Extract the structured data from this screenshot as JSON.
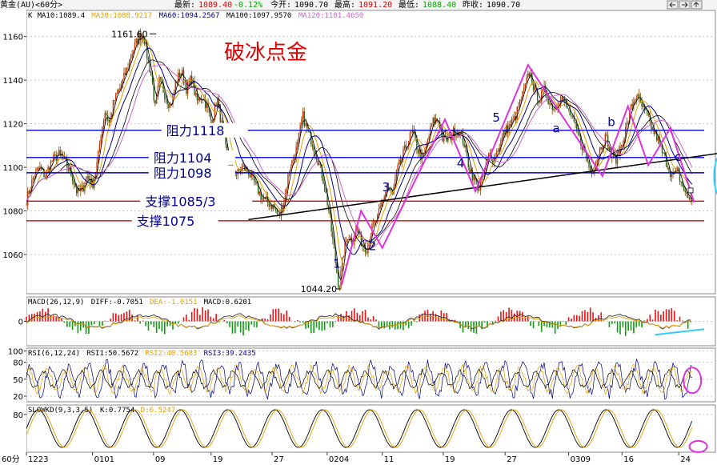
{
  "app": {
    "title": "黄金(AU)<60分>",
    "quote": {
      "latest_label": "最新:",
      "latest": "1089.40",
      "change": "-0.12%",
      "open_label": "今开:",
      "open": "1090.70",
      "high_label": "最高:",
      "high": "1091.20",
      "low_label": "最低:",
      "low": "1088.40",
      "prev_close_label": "昨收:",
      "prev_close": "1090.70"
    },
    "period_label": "60分",
    "nav_icons": [
      "arrow-left-icon",
      "arrow-right-icon",
      "arrow-up-icon"
    ]
  },
  "colors": {
    "ma10": "#000000",
    "ma30": "#e0a000",
    "ma60": "#000080",
    "ma100": "#000000",
    "ma120": "#cc66cc",
    "resistance_line": "#0000cc",
    "support_line": "#dd0000",
    "trend_line": "#000000",
    "wave_line": "#dd33dd",
    "annotation_blue": "#000090",
    "annotation_red": "#dd0000",
    "ellipse_cyan": "#33ccff",
    "candle": "#8a5a1a"
  },
  "chart_data": [
    {
      "type": "candlestick",
      "name": "price",
      "legend": [
        {
          "key": "K",
          "text": "K",
          "color": "#000000"
        },
        {
          "key": "ma10",
          "text": "MA10:1089.4",
          "color": "#000000"
        },
        {
          "key": "ma30",
          "text": "MA30:1088.9217",
          "color": "#e0a000"
        },
        {
          "key": "ma60",
          "text": "MA60:1094.2567",
          "color": "#000080"
        },
        {
          "key": "ma100",
          "text": "MA100:1097.9570",
          "color": "#000000"
        },
        {
          "key": "ma120",
          "text": "MA120:1101.4650",
          "color": "#cc66cc"
        }
      ],
      "ylim": [
        1042,
        1172
      ],
      "yticks": [
        1060,
        1080,
        1100,
        1120,
        1140,
        1160
      ],
      "ytick_labels": [
        "1060",
        "1080",
        "1100",
        "1120",
        "1140",
        "1160"
      ],
      "x_dates": [
        "1223",
        "0101",
        "09",
        "19",
        "27",
        "0204",
        "11",
        "19",
        "27",
        "0309",
        "16",
        "24"
      ],
      "x_date_pos": [
        0,
        78,
        150,
        218,
        290,
        355,
        420,
        492,
        565,
        640,
        703,
        770
      ],
      "x_range": [
        0,
        800
      ],
      "price_path": [
        [
          0,
          1085
        ],
        [
          8,
          1095
        ],
        [
          15,
          1100
        ],
        [
          22,
          1096
        ],
        [
          30,
          1103
        ],
        [
          38,
          1106
        ],
        [
          46,
          1102
        ],
        [
          54,
          1096
        ],
        [
          60,
          1088
        ],
        [
          66,
          1090
        ],
        [
          72,
          1096
        ],
        [
          78,
          1092
        ],
        [
          84,
          1103
        ],
        [
          88,
          1116
        ],
        [
          93,
          1126
        ],
        [
          98,
          1120
        ],
        [
          103,
          1130
        ],
        [
          110,
          1136
        ],
        [
          118,
          1144
        ],
        [
          125,
          1153
        ],
        [
          133,
          1160
        ],
        [
          138,
          1161.6
        ],
        [
          142,
          1152
        ],
        [
          148,
          1141
        ],
        [
          152,
          1127
        ],
        [
          157,
          1140
        ],
        [
          163,
          1134
        ],
        [
          170,
          1128
        ],
        [
          177,
          1140
        ],
        [
          183,
          1144
        ],
        [
          189,
          1136
        ],
        [
          195,
          1141
        ],
        [
          201,
          1130
        ],
        [
          207,
          1133
        ],
        [
          213,
          1128
        ],
        [
          219,
          1120
        ],
        [
          225,
          1132
        ],
        [
          231,
          1118
        ],
        [
          237,
          1104
        ],
        [
          243,
          1098
        ],
        [
          249,
          1097
        ],
        [
          255,
          1100
        ],
        [
          262,
          1098
        ],
        [
          270,
          1092
        ],
        [
          278,
          1086
        ],
        [
          285,
          1084
        ],
        [
          292,
          1082
        ],
        [
          298,
          1077
        ],
        [
          305,
          1086
        ],
        [
          310,
          1099
        ],
        [
          315,
          1104
        ],
        [
          320,
          1110
        ],
        [
          326,
          1124
        ],
        [
          331,
          1117
        ],
        [
          337,
          1112
        ],
        [
          343,
          1105
        ],
        [
          350,
          1095
        ],
        [
          357,
          1080
        ],
        [
          363,
          1062
        ],
        [
          369,
          1044.2
        ],
        [
          374,
          1060
        ],
        [
          379,
          1069
        ],
        [
          385,
          1066
        ],
        [
          390,
          1072
        ],
        [
          396,
          1065
        ],
        [
          402,
          1063
        ],
        [
          408,
          1072
        ],
        [
          414,
          1076
        ],
        [
          420,
          1084
        ],
        [
          426,
          1092
        ],
        [
          432,
          1087
        ],
        [
          438,
          1099
        ],
        [
          444,
          1105
        ],
        [
          450,
          1112
        ],
        [
          456,
          1116
        ],
        [
          462,
          1108
        ],
        [
          468,
          1104
        ],
        [
          474,
          1113
        ],
        [
          480,
          1121
        ],
        [
          486,
          1122
        ],
        [
          492,
          1112
        ],
        [
          498,
          1113
        ],
        [
          504,
          1116
        ],
        [
          510,
          1117
        ],
        [
          516,
          1112
        ],
        [
          522,
          1101
        ],
        [
          528,
          1095
        ],
        [
          534,
          1090
        ],
        [
          540,
          1096
        ],
        [
          546,
          1106
        ],
        [
          552,
          1104
        ],
        [
          558,
          1110
        ],
        [
          564,
          1116
        ],
        [
          570,
          1119
        ],
        [
          576,
          1122
        ],
        [
          582,
          1129
        ],
        [
          588,
          1136
        ],
        [
          594,
          1144
        ],
        [
          600,
          1135
        ],
        [
          606,
          1131
        ],
        [
          612,
          1136
        ],
        [
          618,
          1129
        ],
        [
          624,
          1127
        ],
        [
          630,
          1133
        ],
        [
          636,
          1129
        ],
        [
          642,
          1124
        ],
        [
          648,
          1118
        ],
        [
          654,
          1112
        ],
        [
          660,
          1106
        ],
        [
          666,
          1098
        ],
        [
          672,
          1102
        ],
        [
          678,
          1110
        ],
        [
          684,
          1114
        ],
        [
          690,
          1105
        ],
        [
          696,
          1104
        ],
        [
          702,
          1110
        ],
        [
          708,
          1118
        ],
        [
          714,
          1128
        ],
        [
          720,
          1133
        ],
        [
          726,
          1128
        ],
        [
          732,
          1124
        ],
        [
          738,
          1118
        ],
        [
          744,
          1114
        ],
        [
          750,
          1107
        ],
        [
          756,
          1102
        ],
        [
          762,
          1096
        ],
        [
          768,
          1098
        ],
        [
          774,
          1092
        ],
        [
          780,
          1086
        ]
      ],
      "last_price_marker": {
        "x": 784,
        "y": 1089.4
      },
      "high_label": {
        "text": "1161.60",
        "x": 138,
        "y": 1161.6
      },
      "low_label": {
        "text": "1044.20",
        "x": 369,
        "y": 1044.2
      },
      "horizontal_levels": [
        {
          "label": "阻力1118",
          "value": 1117,
          "type": "resistance",
          "x_label": 165
        },
        {
          "label": "阻力1104",
          "value": 1104.5,
          "type": "resistance",
          "x_label": 150
        },
        {
          "label": "阻力1098",
          "value": 1097.5,
          "type": "resistance",
          "x_label": 150
        },
        {
          "label": "支撑1085/3",
          "value": 1084.5,
          "type": "support",
          "x_label": 140
        },
        {
          "label": "支撑1075",
          "value": 1075.5,
          "type": "support",
          "x_label": 130
        }
      ],
      "trend_line": {
        "from": [
          262,
          1076
        ],
        "to": [
          846,
          1108
        ]
      },
      "wave_path": [
        [
          372,
          1046
        ],
        [
          395,
          1080
        ],
        [
          420,
          1063
        ],
        [
          494,
          1122
        ],
        [
          530,
          1089
        ],
        [
          592,
          1147
        ],
        [
          680,
          1096
        ],
        [
          710,
          1128
        ],
        [
          734,
          1101
        ],
        [
          760,
          1118
        ],
        [
          788,
          1084
        ]
      ],
      "wave_labels": [
        {
          "text": "1",
          "x": 362,
          "y": 1054
        },
        {
          "text": "2",
          "x": 404,
          "y": 1062
        },
        {
          "text": "3",
          "x": 420,
          "y": 1089
        },
        {
          "text": "4",
          "x": 508,
          "y": 1100
        },
        {
          "text": "5",
          "x": 550,
          "y": 1121
        },
        {
          "text": "a",
          "x": 621,
          "y": 1116
        },
        {
          "text": "b",
          "x": 686,
          "y": 1119
        },
        {
          "text": "c",
          "x": 765,
          "y": 1103
        }
      ],
      "title_annotation": "破冰点金",
      "ellipse": {
        "x": 823,
        "y": 1096
      }
    },
    {
      "type": "bar",
      "name": "MACD",
      "legend": [
        {
          "text": "MACD(26,12,9)",
          "color": "#000000"
        },
        {
          "text": "DIFF:-0.7051",
          "color": "#000000"
        },
        {
          "text": "DEA:-1.0151",
          "color": "#e0a000"
        },
        {
          "text": "MACD:0.6201",
          "color": "#000000"
        }
      ],
      "ylim": [
        -10,
        10
      ],
      "yticks": [
        0
      ],
      "ytick_labels": [
        "0"
      ]
    },
    {
      "type": "line",
      "name": "RSI",
      "legend": [
        {
          "text": "RSI(6,12,24)",
          "color": "#000000"
        },
        {
          "text": "RSI1:50.5672",
          "color": "#000000"
        },
        {
          "text": "RSI2:40.5683",
          "color": "#e0a000"
        },
        {
          "text": "RSI3:39.2435",
          "color": "#000080"
        }
      ],
      "ylim": [
        10,
        105
      ],
      "yticks": [
        20,
        50,
        80,
        100
      ],
      "ytick_labels": [
        "20",
        "50",
        "80",
        "100"
      ]
    },
    {
      "type": "line",
      "name": "SLOWKD",
      "legend": [
        {
          "text": "SLOWKD(9,3,3,5)",
          "color": "#000000"
        },
        {
          "text": "K:0.7754",
          "color": "#000000"
        },
        {
          "text": "D:6.5247",
          "color": "#e0a000"
        }
      ],
      "ylim": [
        0,
        100
      ],
      "yticks": [
        80
      ],
      "ytick_labels": [
        "80"
      ]
    }
  ]
}
